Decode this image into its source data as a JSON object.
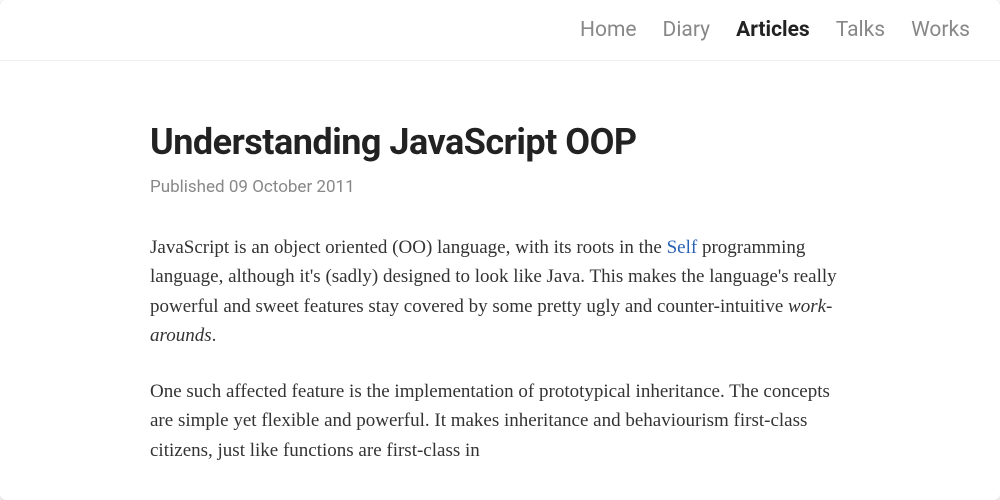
{
  "nav": {
    "items": [
      {
        "label": "Home",
        "active": false
      },
      {
        "label": "Diary",
        "active": false
      },
      {
        "label": "Articles",
        "active": true
      },
      {
        "label": "Talks",
        "active": false
      },
      {
        "label": "Works",
        "active": false
      }
    ]
  },
  "article": {
    "title": "Understanding JavaScript OOP",
    "published_prefix": "Published ",
    "published_date": "09 October 2011",
    "p1_a": "JavaScript is an object oriented (OO) language, with its roots in the ",
    "p1_link": "Self",
    "p1_b": " programming language, although it's (sadly) designed to look like Java. This makes the language's really powerful and sweet features stay covered by some pretty ugly and counter-intuitive ",
    "p1_em": "work-arounds",
    "p1_c": ".",
    "p2": "One such affected feature is the implementation of prototypical inheritance. The concepts are simple yet flexible and powerful. It makes inheritance and behaviourism first-class citizens, just like functions are first-class in"
  }
}
